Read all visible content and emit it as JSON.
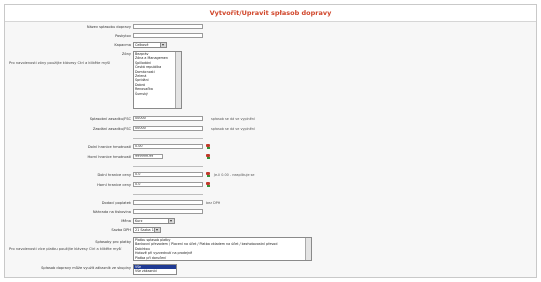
{
  "page": {
    "title": "Vytvořit/Upravit spłasob dopravy"
  },
  "form": {
    "name_label": "Název spłasobu dopravy",
    "name_value": "",
    "provider_label": "Poskytov",
    "provider_value": "",
    "currency_label": "Kapacma",
    "currency_value": "Celkové",
    "zones_label": "Zóny",
    "zones_note": "Pro navolenosti zóny použijte klávesy Ctrl a klikěte myší",
    "zones_items": [
      "Bezpráv",
      "Zóna a Managemen",
      "Spillodáni",
      "Česká republika",
      "Domácnosti",
      "Zelená",
      "Sprídáni",
      "Dobrá",
      "Renovačka",
      "Šumský"
    ],
    "price_label": "Spłasobní zasadku/FSC",
    "price_value": "00000",
    "price_note": "spłasob se dá ve vyplnění",
    "price2_label": "Zasdání zasadku/FSC",
    "price2_value": "00000",
    "price2_note": "spłasob se dá ve vyplnění",
    "weight_min_label": "Dolní hranice hmotnosti",
    "weight_min_value": "0.00",
    "weight_max_label": "Horní hranice hmotnosti",
    "weight_max_value": "999999.99",
    "order_min_label": "Dolní hranice ceny",
    "order_min_value": "0.0",
    "order_min_note": "Je-li 0.00 - neaplikuje se",
    "order_max_label": "Horní hranice ceny",
    "order_max_value": "0.0",
    "shipping_label": "Dodací poplatek",
    "shipping_value": "",
    "shipping_note": "bez DPH",
    "shipping2_label": "Náhrada na tiskovina",
    "shipping2_value": "",
    "currency2_label": "Měna",
    "currency2_value": "Kurz",
    "tax_label": "Sazba DPH",
    "tax_value": "21 Sazba 1",
    "payments_label": "Spłasoby pro platby",
    "payments_note": "Pro navolenosti více platbu použijte klávesy Ctrl a klikěte myší",
    "payments_items": [
      "Platbu spłasob platby",
      "Bankovní převodem / Placení na účet / Platba vkladem na účet / bezhotovostní převod",
      "Dobírkou",
      "Hotově při vyzvednutí na prodejně",
      "Platba při doručení"
    ],
    "bottom_label": "Spłasob dopravy může využít zákazník ze skupiny",
    "bottom_items": [
      "Vše",
      "Vše zákazníci"
    ]
  }
}
